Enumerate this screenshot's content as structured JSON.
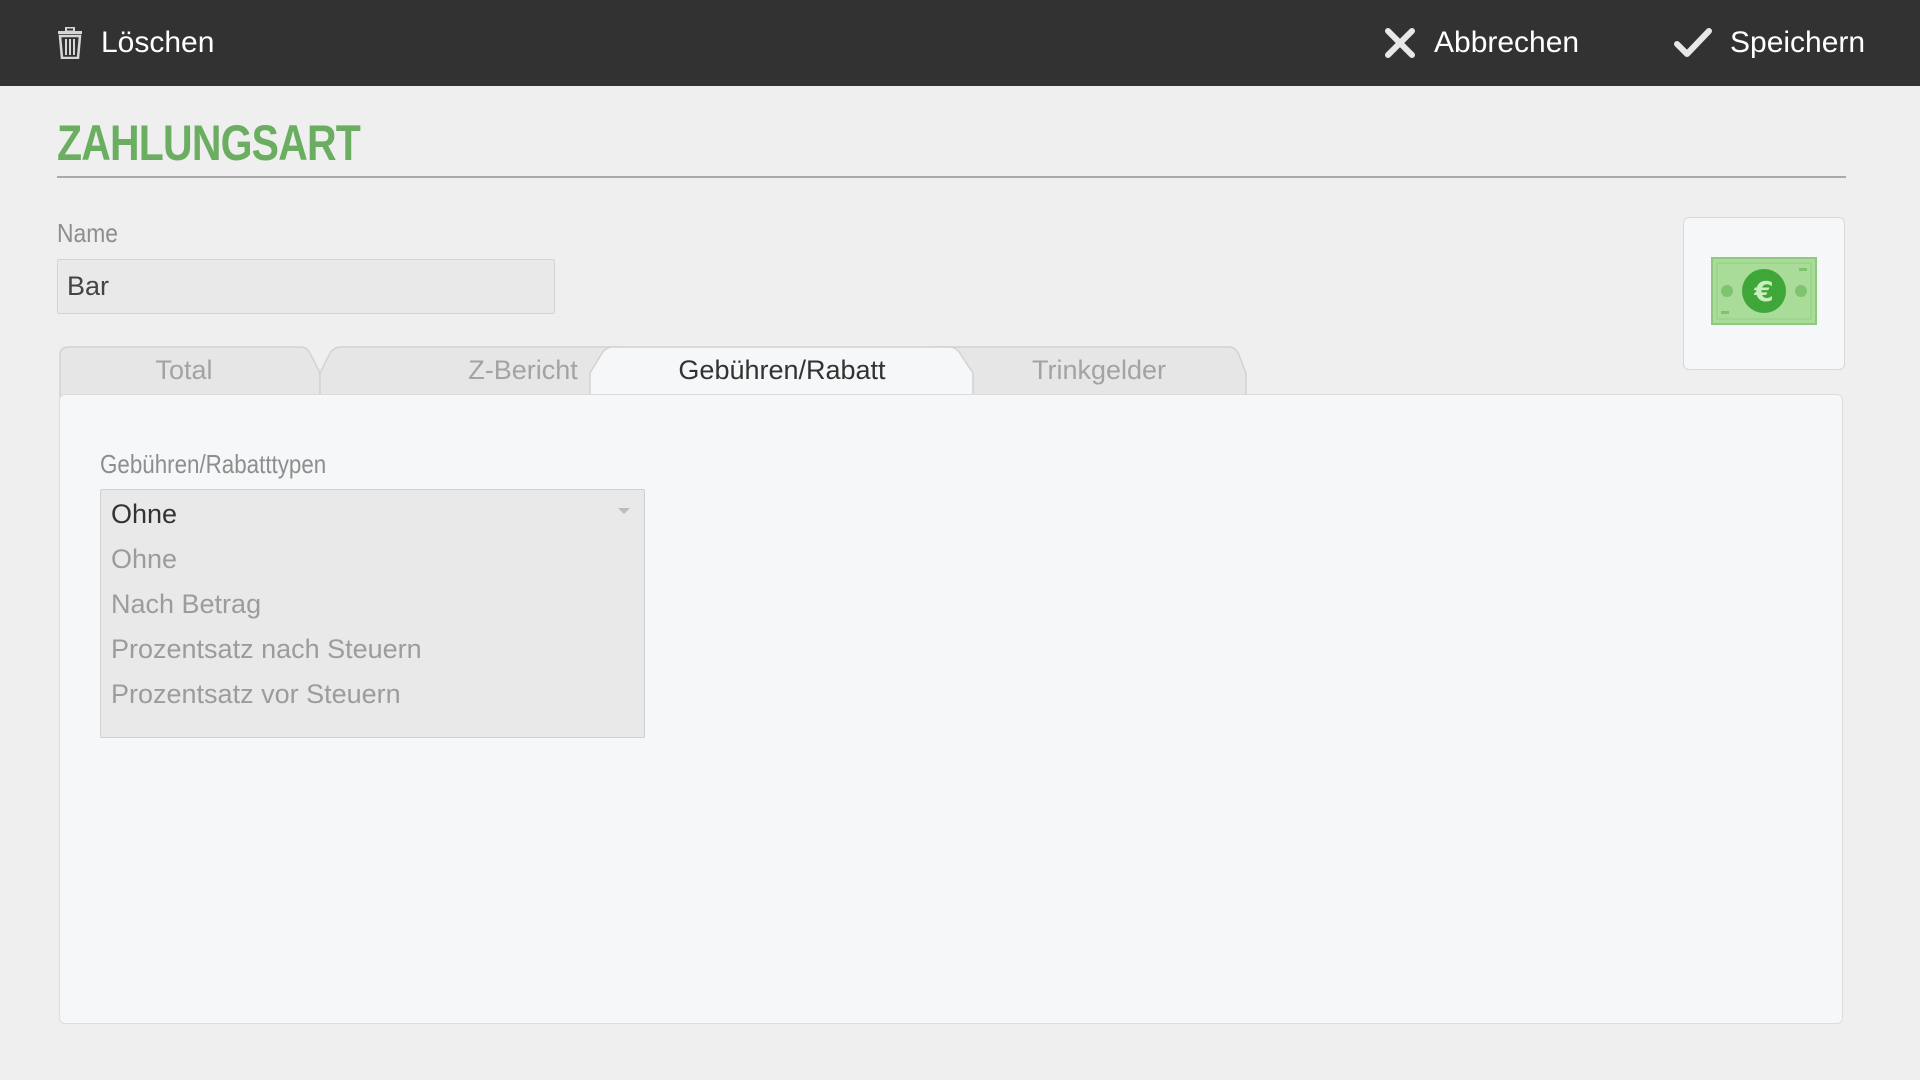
{
  "toolbar": {
    "delete_label": "Löschen",
    "cancel_label": "Abbrechen",
    "save_label": "Speichern"
  },
  "page": {
    "title": "ZAHLUNGSART"
  },
  "name_field": {
    "label": "Name",
    "value": "Bar"
  },
  "icon": {
    "name": "euro-banknote-icon",
    "color": "#3fa63a"
  },
  "tabs": [
    {
      "label": "Total",
      "active": false
    },
    {
      "label": "Z-Bericht",
      "active": false
    },
    {
      "label": "Gebühren/Rabatt",
      "active": true
    },
    {
      "label": "Trinkgelder",
      "active": false
    }
  ],
  "fee_section": {
    "label": "Gebühren/Rabatttypen",
    "selected": "Ohne",
    "options": [
      "Ohne",
      "Nach Betrag",
      "Prozentsatz nach Steuern",
      "Prozentsatz vor Steuern"
    ]
  },
  "colors": {
    "toolbar_bg": "#323232",
    "accent": "#6bae62",
    "panel_bg": "#f6f7f8"
  }
}
